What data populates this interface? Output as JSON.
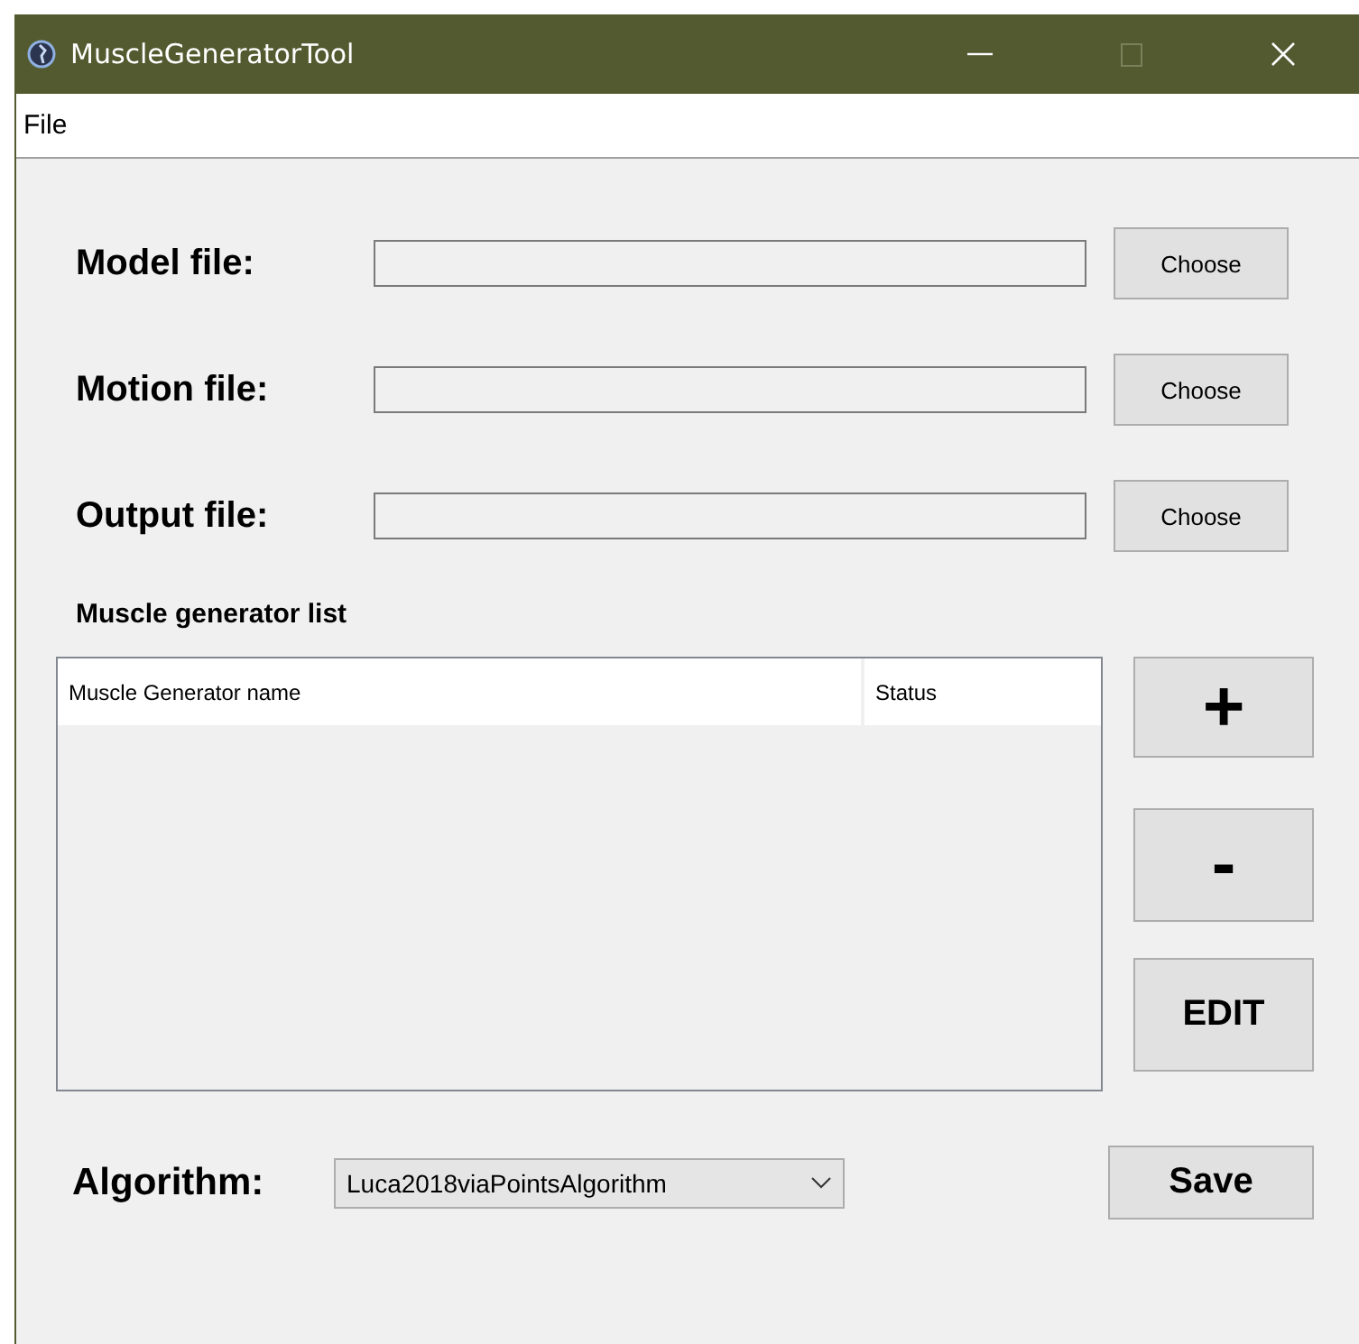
{
  "window": {
    "title": "MuscleGeneratorTool",
    "controls": [
      {
        "kind": "minimize"
      },
      {
        "kind": "maximize"
      },
      {
        "kind": "close"
      }
    ]
  },
  "menu": [
    "File"
  ],
  "file_rows": [
    {
      "label": "Model file:",
      "value": "",
      "button": "Choose"
    },
    {
      "label": "Motion file:",
      "value": "",
      "button": "Choose"
    },
    {
      "label": "Output file:",
      "value": "",
      "button": "Choose"
    }
  ],
  "list_title": "Muscle generator list",
  "table": {
    "columns": [
      "Muscle Generator name",
      "Status"
    ]
  },
  "side_buttons": [
    "+",
    "-",
    "EDIT"
  ],
  "algorithm": {
    "label": "Algorithm:",
    "value": "Luca2018viaPointsAlgorithm"
  },
  "save_button": "Save"
}
